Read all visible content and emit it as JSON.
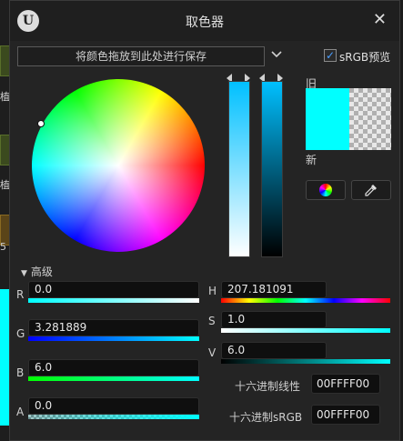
{
  "background": {
    "left_texts": [
      "植",
      "植",
      "5"
    ]
  },
  "dialog": {
    "title": "取色器",
    "logo_letter": "U",
    "close_glyph": "✕",
    "save_bar": "将颜色拖放到此处进行保存",
    "srgb_checked": true,
    "srgb_check_glyph": "✓",
    "srgb_label": "sRGB预览",
    "old_label": "旧",
    "new_label": "新",
    "old_color": "#00ffff",
    "advanced_label": "高级"
  },
  "rgba": {
    "r_label": "R",
    "r_value": "0.0",
    "g_label": "G",
    "g_value": "3.281889",
    "b_label": "B",
    "b_value": "6.0",
    "a_label": "A",
    "a_value": "0.0"
  },
  "hsv": {
    "h_label": "H",
    "h_value": "207.181091",
    "s_label": "S",
    "s_value": "1.0",
    "v_label": "V",
    "v_value": "6.0"
  },
  "hex": {
    "linear_label": "十六进制线性",
    "linear_value": "00FFFF00",
    "srgb_label": "十六进制sRGB",
    "srgb_value": "00FFFF00"
  }
}
